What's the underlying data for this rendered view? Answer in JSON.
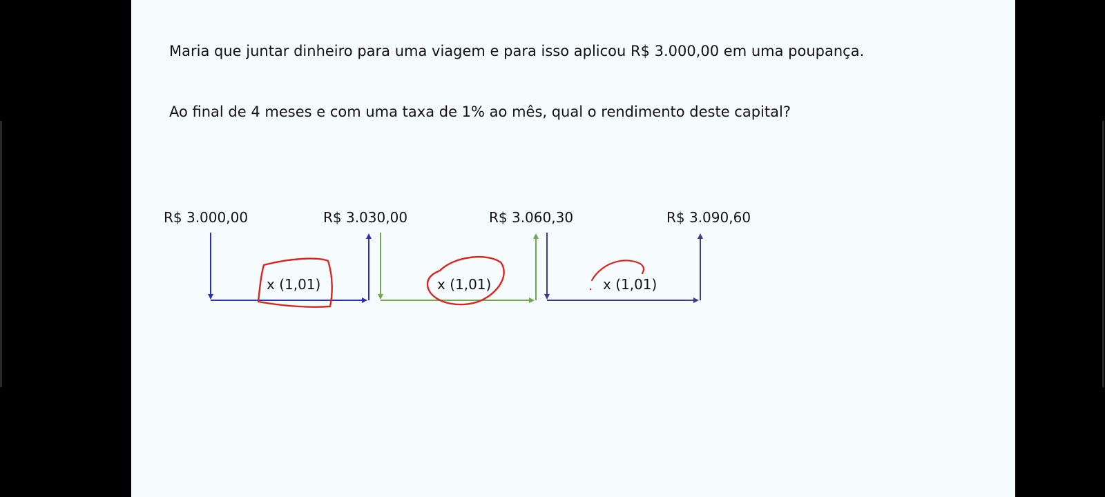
{
  "question": {
    "line1": "Maria que juntar dinheiro para uma viagem e para isso aplicou R$ 3.000,00 em uma poupança.",
    "line2": "Ao final de 4 meses e com uma taxa de 1% ao mês, qual o rendimento deste capital?"
  },
  "timeline": {
    "amounts": [
      "R$ 3.000,00",
      "R$ 3.030,00",
      "R$ 3.060,30",
      "R$ 3.090,60"
    ],
    "factors": [
      "x (1,01)",
      "x (1,01)",
      "x (1,01)"
    ],
    "colors": {
      "segment1": "#2a2fb8",
      "segment2": "#6fa84e",
      "segment3": "#3b3a8c",
      "annotation": "#d8261f"
    }
  }
}
